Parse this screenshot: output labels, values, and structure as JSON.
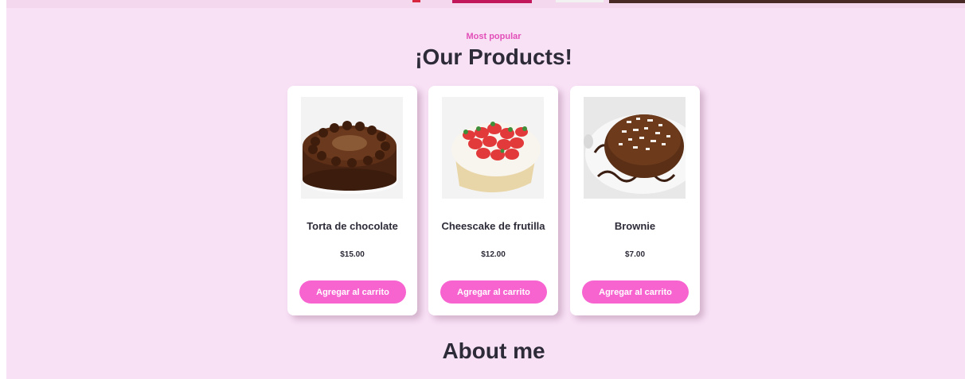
{
  "section": {
    "eyebrow": "Most popular",
    "title": "¡Our Products!"
  },
  "products": [
    {
      "name": "Torta de chocolate",
      "price": "$15.00",
      "button": "Agregar al carrito",
      "image_icon": "chocolate-cake-image"
    },
    {
      "name": "Cheescake de frutilla",
      "price": "$12.00",
      "button": "Agregar al carrito",
      "image_icon": "strawberry-cheesecake-image"
    },
    {
      "name": "Brownie",
      "price": "$7.00",
      "button": "Agregar al carrito",
      "image_icon": "brownie-image"
    }
  ],
  "about": {
    "title": "About me"
  },
  "colors": {
    "background": "#f8e0f5",
    "accent": "#f764d0",
    "eyebrow": "#e24fb8",
    "text": "#2e2b38"
  }
}
